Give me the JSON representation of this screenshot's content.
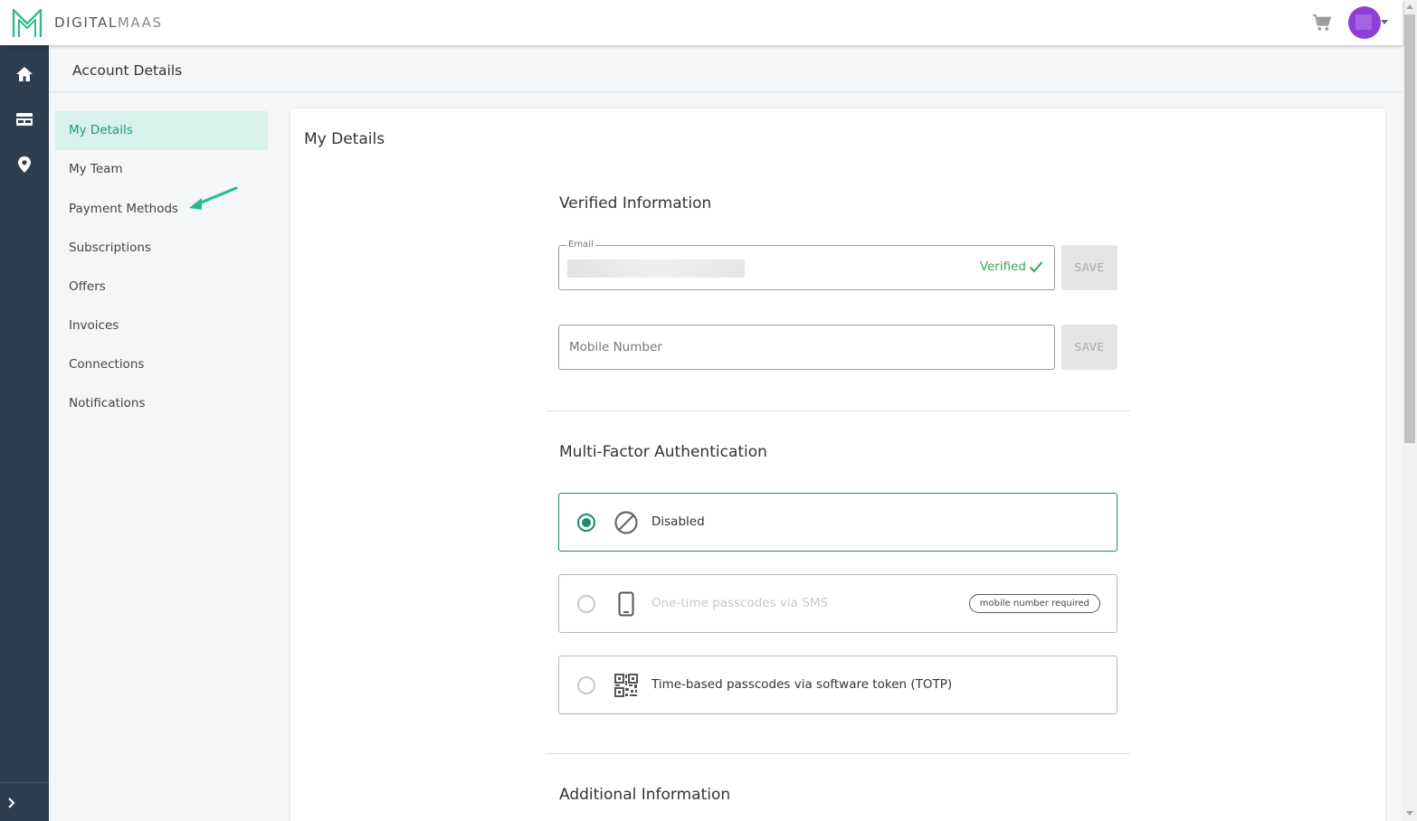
{
  "header": {
    "brand_bold": "DIGITAL",
    "brand_light": "MAAS"
  },
  "page": {
    "title": "Account Details"
  },
  "subnav": {
    "items": [
      {
        "label": "My Details"
      },
      {
        "label": "My Team"
      },
      {
        "label": "Payment Methods"
      },
      {
        "label": "Subscriptions"
      },
      {
        "label": "Offers"
      },
      {
        "label": "Invoices"
      },
      {
        "label": "Connections"
      },
      {
        "label": "Notifications"
      }
    ]
  },
  "card": {
    "title": "My Details",
    "verified_section": {
      "title": "Verified Information",
      "email_legend": "Email",
      "verified_label": "Verified",
      "mobile_placeholder": "Mobile Number",
      "save_label": "SAVE"
    },
    "mfa_section": {
      "title": "Multi-Factor Authentication",
      "options": [
        {
          "label": "Disabled"
        },
        {
          "label": "One-time passcodes via SMS",
          "badge": "mobile number required"
        },
        {
          "label": "Time-based passcodes via software token (TOTP)"
        }
      ]
    },
    "additional_section": {
      "title": "Additional Information"
    }
  },
  "colors": {
    "accent": "#1a8a70",
    "rail": "#2c3e4f",
    "verified": "#3aa655",
    "avatar": "#8e3fd6"
  },
  "icons": {
    "logo": "digitalmaas-logo",
    "cart": "cart-icon",
    "rail": [
      "home-icon",
      "card-icon",
      "location-pin-icon"
    ],
    "mfa": [
      "ban-icon",
      "phone-icon",
      "qr-code-icon"
    ]
  }
}
